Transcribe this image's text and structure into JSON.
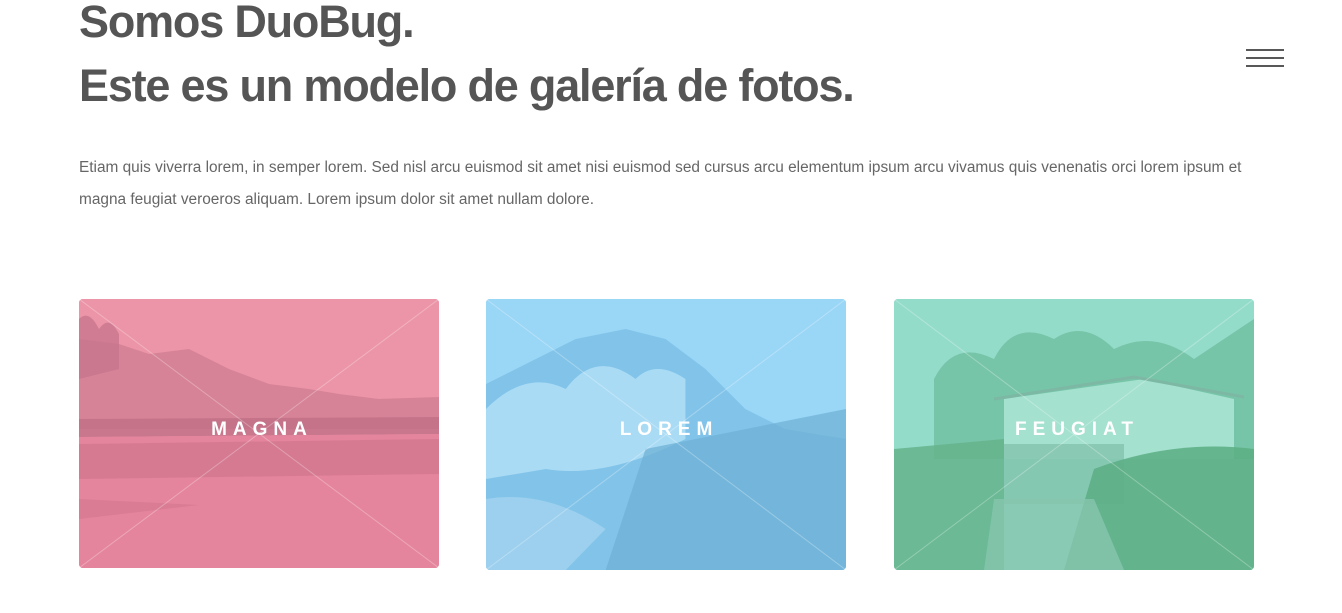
{
  "header": {
    "title_line1": "Somos DuoBug.",
    "title_line2": "Este es un modelo de galería de fotos."
  },
  "menu": {
    "icon": "hamburger-menu-icon"
  },
  "intro": {
    "text": "Etiam quis viverra lorem, in semper lorem. Sed nisl arcu euismod sit amet nisi euismod sed cursus arcu elementum ipsum arcu vivamus quis venenatis orci lorem ipsum et magna feugiat veroeros aliquam. Lorem ipsum dolor sit amet nullam dolore."
  },
  "gallery": {
    "tiles": [
      {
        "label": "MAGNA",
        "color": "#e993a6"
      },
      {
        "label": "LOREM",
        "color": "#94cdef"
      },
      {
        "label": "FEUGIAT",
        "color": "#8fd8c4"
      }
    ]
  }
}
